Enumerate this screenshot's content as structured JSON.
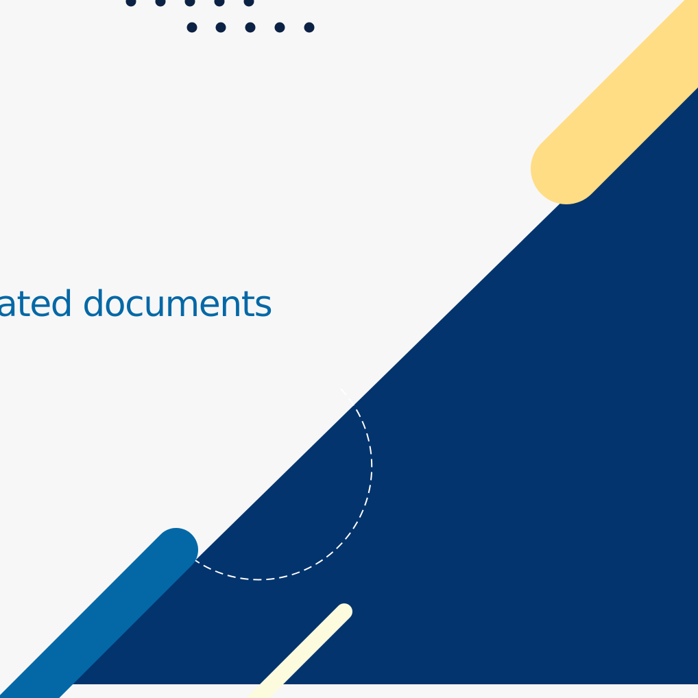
{
  "headline": {
    "text": "ated documents"
  },
  "colors": {
    "background": "#f7f7f7",
    "navy": "#03346d",
    "dots": "#0c2244",
    "yellow": "#ffdd85",
    "blue": "#0468a6",
    "cream": "#fcfbde",
    "dashed_arc": "#ffffff"
  },
  "decorations": [
    "dot-grid",
    "navy-triangle",
    "yellow-pill",
    "blue-pill",
    "cream-stroke",
    "dashed-arc"
  ]
}
